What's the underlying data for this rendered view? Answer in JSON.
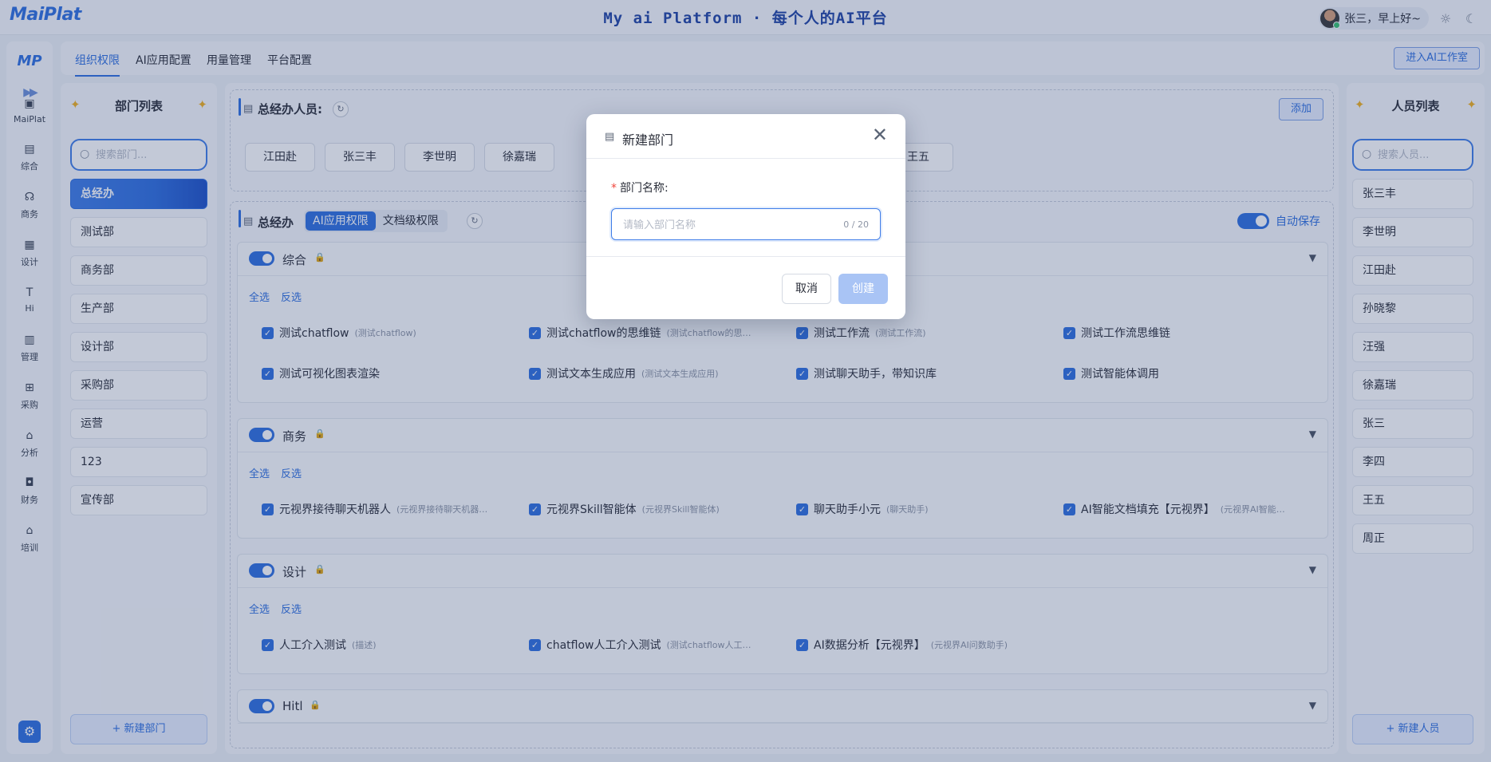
{
  "header": {
    "logo": "MaiPlat",
    "title": "My ai Platform · 每个人的AI平台",
    "greeting": "张三，早上好~",
    "icons": [
      "sun-icon",
      "moon-icon"
    ]
  },
  "rail": {
    "logo": "MP",
    "items": [
      {
        "label": "MaiPlat",
        "icon": "robot-icon",
        "glyph": "▣"
      },
      {
        "label": "综合",
        "icon": "save-icon",
        "glyph": "▤"
      },
      {
        "label": "商务",
        "icon": "headset-icon",
        "glyph": "☊"
      },
      {
        "label": "设计",
        "icon": "document-icon",
        "glyph": "▦"
      },
      {
        "label": "Hi",
        "icon": "text-icon",
        "glyph": "T"
      },
      {
        "label": "管理",
        "icon": "archive-icon",
        "glyph": "▥"
      },
      {
        "label": "采购",
        "icon": "cart-icon",
        "glyph": "⊞"
      },
      {
        "label": "分析",
        "icon": "home-icon",
        "glyph": "⌂"
      },
      {
        "label": "财务",
        "icon": "lock-icon",
        "glyph": "◘"
      },
      {
        "label": "培训",
        "icon": "home-icon",
        "glyph": "⌂"
      }
    ]
  },
  "subnav": {
    "tabs": [
      "组织权限",
      "AI应用配置",
      "用量管理",
      "平台配置"
    ],
    "enter_button": "进入AI工作室"
  },
  "dept_panel": {
    "title": "部门列表",
    "search_placeholder": "搜索部门...",
    "items": [
      "总经办",
      "测试部",
      "商务部",
      "生产部",
      "设计部",
      "采购部",
      "运营",
      "123",
      "宣传部"
    ],
    "active_index": 0,
    "new_button": "+ 新建部门"
  },
  "members": {
    "title": "总经办人员:",
    "add_button": "添加",
    "chips": [
      "江田赴",
      "张三丰",
      "李世明",
      "徐嘉瑞",
      "",
      "",
      "",
      "",
      "王五"
    ]
  },
  "permissions": {
    "dept_name": "总经办",
    "segments": [
      "AI应用权限",
      "文档级权限"
    ],
    "active_segment": 0,
    "autosave_label": "自动保存",
    "select_all": "全选",
    "invert": "反选",
    "groups": [
      {
        "name": "综合",
        "items": [
          {
            "name": "测试chatflow",
            "desc": "(测试chatflow)"
          },
          {
            "name": "测试chatflow的思维链",
            "desc": "(测试chatflow的思…"
          },
          {
            "name": "测试工作流",
            "desc": "(测试工作流)"
          },
          {
            "name": "测试工作流思维链",
            "desc": ""
          },
          {
            "name": "测试可视化图表渲染",
            "desc": ""
          },
          {
            "name": "测试文本生成应用",
            "desc": "(测试文本生成应用)"
          },
          {
            "name": "测试聊天助手，带知识库",
            "desc": ""
          },
          {
            "name": "测试智能体调用",
            "desc": ""
          }
        ]
      },
      {
        "name": "商务",
        "items": [
          {
            "name": "元视界接待聊天机器人",
            "desc": "(元视界接待聊天机器…"
          },
          {
            "name": "元视界Skill智能体",
            "desc": "(元视界Skill智能体)"
          },
          {
            "name": "聊天助手小元",
            "desc": "(聊天助手)"
          },
          {
            "name": "AI智能文档填充【元视界】",
            "desc": "(元视界AI智能…"
          }
        ]
      },
      {
        "name": "设计",
        "items": [
          {
            "name": "人工介入测试",
            "desc": "(描述)"
          },
          {
            "name": "chatflow人工介入测试",
            "desc": "(测试chatflow人工…"
          },
          {
            "name": "AI数据分析【元视界】",
            "desc": "(元视界AI问数助手)"
          }
        ]
      },
      {
        "name": "Hitl",
        "items": []
      }
    ]
  },
  "people_panel": {
    "title": "人员列表",
    "search_placeholder": "搜索人员...",
    "items": [
      "张三丰",
      "李世明",
      "江田赴",
      "孙晓黎",
      "汪强",
      "徐嘉瑞",
      "张三",
      "李四",
      "王五",
      "周正"
    ],
    "new_button": "+ 新建人员"
  },
  "modal": {
    "title": "新建部门",
    "field_label": "部门名称:",
    "required_mark": "*",
    "placeholder": "请输入部门名称",
    "counter": "0 / 20",
    "cancel": "取消",
    "create": "创建"
  },
  "colors": {
    "accent": "#2f6fe0",
    "lock": "#e2a12a",
    "overlay": "rgba(40,60,110,0.28)"
  }
}
